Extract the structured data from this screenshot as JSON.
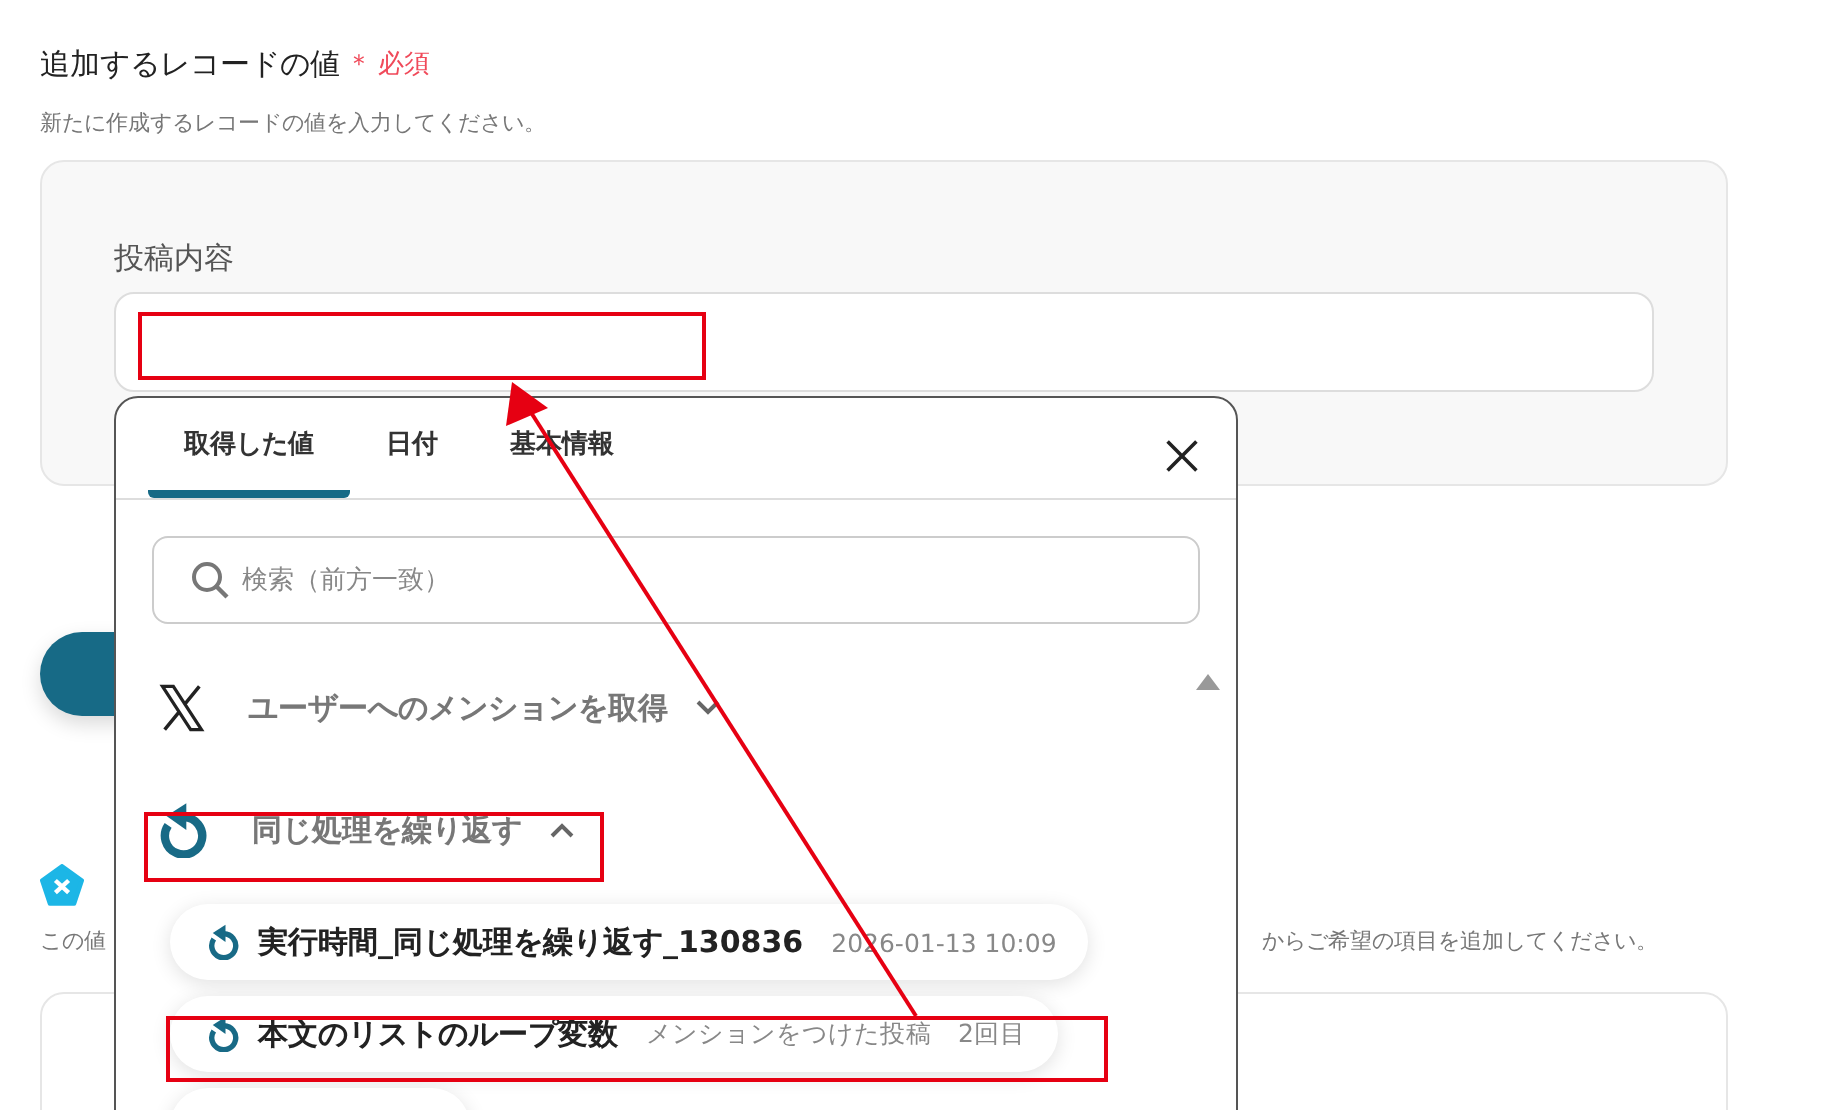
{
  "field_section": {
    "title": "追加するレコードの値",
    "required_mark": "＊",
    "required_label": "必須",
    "description": "新たに作成するレコードの値を入力してください。",
    "fields": [
      {
        "label": "投稿内容"
      }
    ]
  },
  "next_section": {
    "description_start": "この値",
    "description_end": "からご希望の項目を追加してください。"
  },
  "picker": {
    "tabs": [
      {
        "label": "取得した値",
        "selected": true
      },
      {
        "label": "日付",
        "selected": false
      },
      {
        "label": "基本情報",
        "selected": false
      }
    ],
    "search": {
      "placeholder": "検索（前方一致）"
    },
    "groups": [
      {
        "kind": "x",
        "title": "ユーザーへのメンションを取得",
        "expanded": false
      },
      {
        "kind": "loop",
        "title": "同じ処理を繰り返す",
        "expanded": true,
        "items": [
          {
            "name": "実行時間_同じ処理を繰り返す_130836",
            "value": "2026-01-13 10:09"
          },
          {
            "name": "本文のリストのループ変数",
            "value": "メンションをつけた投稿　2回目"
          }
        ]
      }
    ]
  }
}
